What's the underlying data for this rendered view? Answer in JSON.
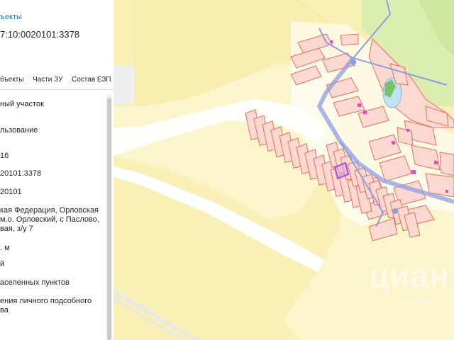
{
  "panel": {
    "objects_link": "ъекты",
    "cadastral_number": "7:10:0020101:3378",
    "tabs": [
      {
        "label": "бъекты"
      },
      {
        "label": "Части ЗУ"
      },
      {
        "label": "Состав ЕЗП"
      }
    ],
    "rows": [
      {
        "lines": [
          "ный участок"
        ]
      },
      {
        "lines": [
          "льзование"
        ]
      },
      {
        "lines": [
          "16"
        ]
      },
      {
        "lines": [
          "20101:3378"
        ]
      },
      {
        "lines": [
          "20101"
        ]
      },
      {
        "lines": [
          "кая Федерация, Орловская",
          "м.о. Орловский, с Паслово,",
          "вая, з/у 7"
        ]
      },
      {
        "lines": [
          ". м"
        ]
      },
      {
        "lines": [
          "й"
        ]
      },
      {
        "lines": [
          "аселенных пунктов"
        ]
      },
      {
        "lines": [
          "ения личного подсобного",
          "ва"
        ]
      }
    ]
  },
  "map": {
    "colors": {
      "land": "#f9f0b8",
      "land_alt": "#fbf5cc",
      "road": "#ffffff",
      "green": "#dbeeb0",
      "parcel_fill": "#fbd8d0",
      "parcel_line": "#e8705e",
      "boundary": "#8e9de0",
      "water": "#bfe3f5",
      "selected": "#a34fc4",
      "building": "#e04fb8"
    },
    "watermark": {
      "brand": "циан",
      "subtitle": "Москва"
    }
  }
}
